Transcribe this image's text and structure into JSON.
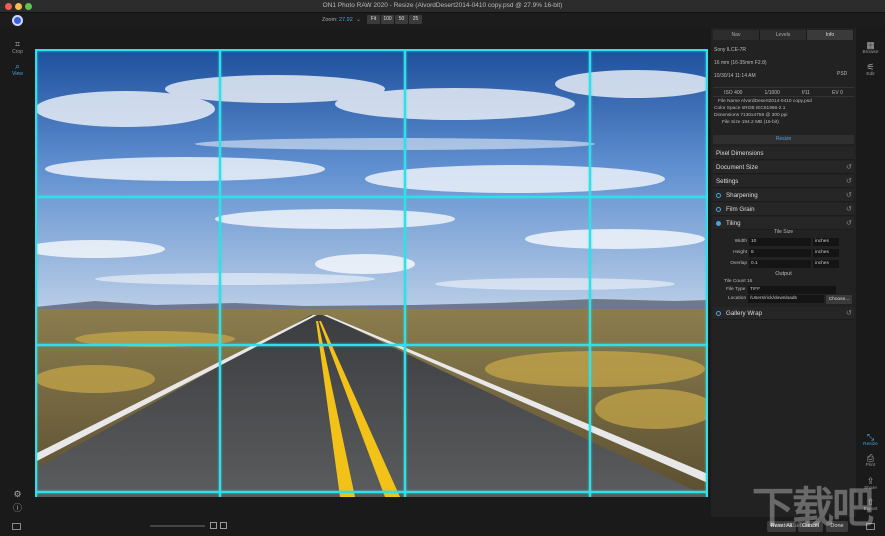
{
  "window": {
    "title": "ON1 Photo RAW 2020 - Resize (AlvordDesert2014-0410 copy.psd @ 27.9% 16-bit)"
  },
  "zoom": {
    "label": "Zoom:",
    "value": "27.92",
    "buttons": [
      "Fit",
      "100",
      "50",
      "25"
    ]
  },
  "left_tools": [
    {
      "label": "Crop",
      "icon": "crop-icon"
    },
    {
      "label": "View",
      "icon": "view-zoom-icon"
    }
  ],
  "right_tools": [
    {
      "label": "Browse",
      "icon": "browse-icon"
    },
    {
      "label": "Edit",
      "icon": "edit-icon"
    },
    {
      "label": "Resize",
      "icon": "resize-icon"
    },
    {
      "label": "Print",
      "icon": "print-icon"
    },
    {
      "label": "Share",
      "icon": "share-icon"
    },
    {
      "label": "Export",
      "icon": "export-icon"
    }
  ],
  "panel": {
    "tabs": [
      "Nav",
      "Levels",
      "Info"
    ],
    "active_tab": "Info",
    "info": {
      "camera": "Sony ILCE-7R",
      "lens": "16 mm (16-35mm F2.8)",
      "date": "10/30/14 11:14 AM",
      "format": "PSD",
      "exif": [
        "ISO 400",
        "1/1000",
        "f/11",
        "EV 0"
      ],
      "file_name": "File Name AlvordDesert2014-0410 copy.psd",
      "color_space": "Color Space sRGB IEC61966-2.1",
      "dimensions": "Dimensions 7130x4759 @ 300 ppi",
      "file_size": "File Size 194.2 MB (16-bit)"
    },
    "resize_header": "Resize",
    "sections": {
      "pixel_dimensions": "Pixel Dimensions",
      "document_size": "Document Size",
      "settings": "Settings",
      "sharpening": "Sharpening",
      "film_grain": "Film Grain",
      "tiling": "Tiling",
      "gallery_wrap": "Gallery Wrap"
    },
    "tile_size": {
      "title": "Tile Size",
      "width_label": "Width",
      "width_value": "10",
      "width_unit": "inches",
      "height_label": "Height",
      "height_value": "8",
      "height_unit": "inches",
      "overlap_label": "Overlap",
      "overlap_value": "0.1",
      "overlap_unit": "inches"
    },
    "output": {
      "title": "Output",
      "tile_count": "Tile Count 16",
      "file_type_label": "File Type",
      "file_type_value": "TIFF",
      "location_label": "Location",
      "location_value": "/Users/rick/downloads",
      "choose_label": "Choose..."
    }
  },
  "bottom_bar": {
    "reset_all": "Reset All",
    "cancel": "Cancel",
    "done": "Done"
  },
  "watermark": {
    "text": "下载吧",
    "url": "www.xiazaiba.com"
  },
  "colors": {
    "accent": "#4aa3e0",
    "grid": "#2fe0e8"
  }
}
